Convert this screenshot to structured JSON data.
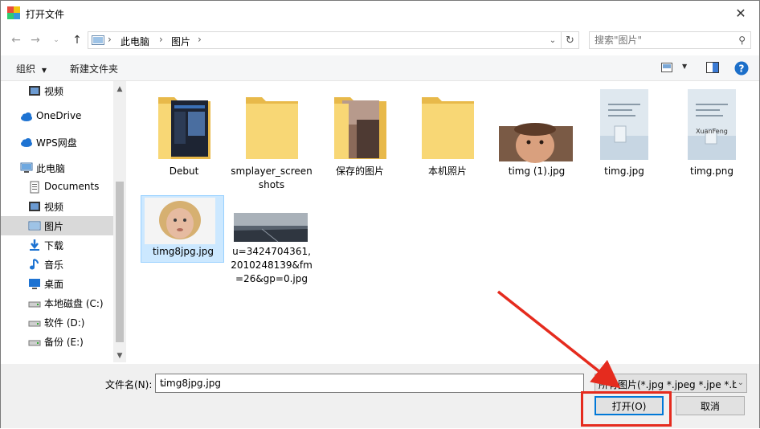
{
  "window": {
    "title": "打开文件"
  },
  "nav": {
    "breadcrumbs": [
      "此电脑",
      "图片"
    ],
    "search_placeholder": "搜索\"图片\""
  },
  "toolbar": {
    "organize": "组织",
    "new_folder": "新建文件夹"
  },
  "sidebar": {
    "items": [
      {
        "label": "视频",
        "icon": "video-icon"
      },
      {
        "label": "OneDrive",
        "icon": "cloud-icon"
      },
      {
        "label": "WPS网盘",
        "icon": "cloud-icon"
      },
      {
        "label": "此电脑",
        "icon": "computer-icon"
      },
      {
        "label": "Documents",
        "icon": "document-icon"
      },
      {
        "label": "视频",
        "icon": "video-icon"
      },
      {
        "label": "图片",
        "icon": "pictures-icon",
        "selected": true
      },
      {
        "label": "下载",
        "icon": "download-icon"
      },
      {
        "label": "音乐",
        "icon": "music-icon"
      },
      {
        "label": "桌面",
        "icon": "desktop-icon"
      },
      {
        "label": "本地磁盘 (C:)",
        "icon": "drive-icon"
      },
      {
        "label": "软件 (D:)",
        "icon": "drive-icon"
      },
      {
        "label": "备份 (E:)",
        "icon": "drive-icon"
      }
    ]
  },
  "files": [
    {
      "name": "Debut",
      "kind": "folder"
    },
    {
      "name": "smplayer_screenshots",
      "kind": "folder"
    },
    {
      "name": "保存的图片",
      "kind": "folder"
    },
    {
      "name": "本机照片",
      "kind": "folder"
    },
    {
      "name": "timg (1).jpg",
      "kind": "image"
    },
    {
      "name": "timg.jpg",
      "kind": "image"
    },
    {
      "name": "timg.png",
      "kind": "image"
    },
    {
      "name": "timg8jpg.jpg",
      "kind": "image",
      "selected": true
    },
    {
      "name": "u=3424704361,2010248139&fm=26&gp=0.jpg",
      "kind": "image"
    }
  ],
  "thumb_text": {
    "card_brand": "XuanFeng"
  },
  "bottom": {
    "filename_label": "文件名(N):",
    "filename_value": "timg8jpg.jpg",
    "filter_value": "所有图片(*.jpg *.jpeg *.jpe *.b",
    "open_button": "打开(O)",
    "cancel_button": "取消"
  },
  "colors": {
    "selection": "#cce8ff",
    "accent": "#0078d7",
    "annotation": "#e52b1e",
    "folder": "#f8d775"
  }
}
